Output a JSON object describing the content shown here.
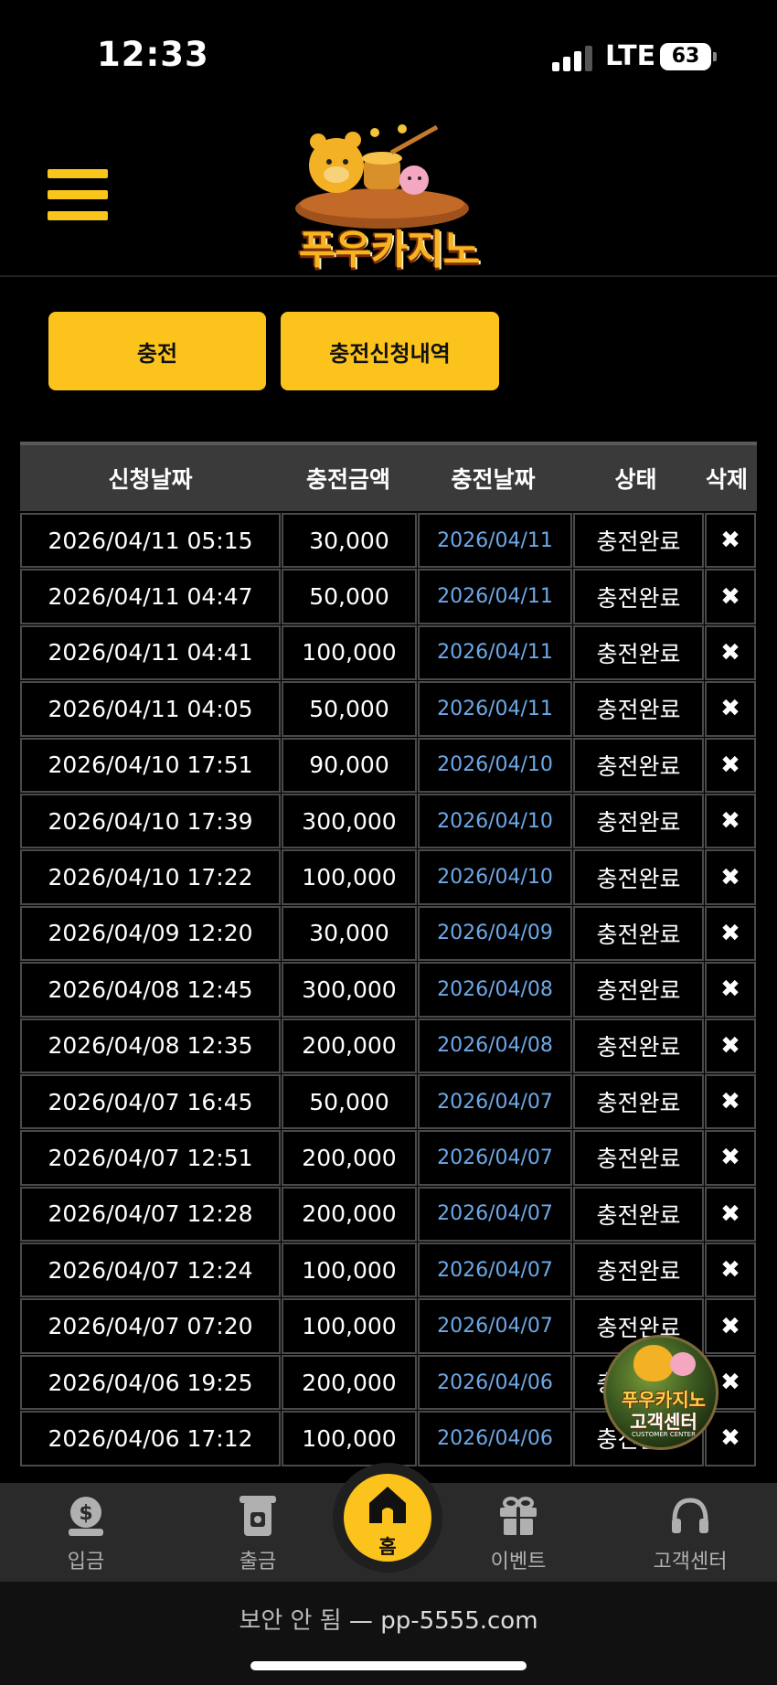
{
  "status_bar": {
    "time": "12:33",
    "network": "LTE",
    "battery": "63"
  },
  "header": {
    "logo_text": "푸우카지노",
    "menu_icon": "hamburger-icon"
  },
  "tabs": {
    "deposit_label": "충전",
    "history_label": "충전신청내역"
  },
  "table": {
    "headers": [
      "신청날짜",
      "충전금액",
      "충전날짜",
      "상태",
      "삭제"
    ],
    "rows": [
      {
        "request_date": "2026/04/11 05:15",
        "amount": "30,000",
        "charge_date": "2026/04/11",
        "status": "충전완료",
        "delete": "✖"
      },
      {
        "request_date": "2026/04/11 04:47",
        "amount": "50,000",
        "charge_date": "2026/04/11",
        "status": "충전완료",
        "delete": "✖"
      },
      {
        "request_date": "2026/04/11 04:41",
        "amount": "100,000",
        "charge_date": "2026/04/11",
        "status": "충전완료",
        "delete": "✖"
      },
      {
        "request_date": "2026/04/11 04:05",
        "amount": "50,000",
        "charge_date": "2026/04/11",
        "status": "충전완료",
        "delete": "✖"
      },
      {
        "request_date": "2026/04/10 17:51",
        "amount": "90,000",
        "charge_date": "2026/04/10",
        "status": "충전완료",
        "delete": "✖"
      },
      {
        "request_date": "2026/04/10 17:39",
        "amount": "300,000",
        "charge_date": "2026/04/10",
        "status": "충전완료",
        "delete": "✖"
      },
      {
        "request_date": "2026/04/10 17:22",
        "amount": "100,000",
        "charge_date": "2026/04/10",
        "status": "충전완료",
        "delete": "✖"
      },
      {
        "request_date": "2026/04/09 12:20",
        "amount": "30,000",
        "charge_date": "2026/04/09",
        "status": "충전완료",
        "delete": "✖"
      },
      {
        "request_date": "2026/04/08 12:45",
        "amount": "300,000",
        "charge_date": "2026/04/08",
        "status": "충전완료",
        "delete": "✖"
      },
      {
        "request_date": "2026/04/08 12:35",
        "amount": "200,000",
        "charge_date": "2026/04/08",
        "status": "충전완료",
        "delete": "✖"
      },
      {
        "request_date": "2026/04/07 16:45",
        "amount": "50,000",
        "charge_date": "2026/04/07",
        "status": "충전완료",
        "delete": "✖"
      },
      {
        "request_date": "2026/04/07 12:51",
        "amount": "200,000",
        "charge_date": "2026/04/07",
        "status": "충전완료",
        "delete": "✖"
      },
      {
        "request_date": "2026/04/07 12:28",
        "amount": "200,000",
        "charge_date": "2026/04/07",
        "status": "충전완료",
        "delete": "✖"
      },
      {
        "request_date": "2026/04/07 12:24",
        "amount": "100,000",
        "charge_date": "2026/04/07",
        "status": "충전완료",
        "delete": "✖"
      },
      {
        "request_date": "2026/04/07 07:20",
        "amount": "100,000",
        "charge_date": "2026/04/07",
        "status": "충전완료",
        "delete": "✖"
      },
      {
        "request_date": "2026/04/06 19:25",
        "amount": "200,000",
        "charge_date": "2026/04/06",
        "status": "충전완료",
        "delete": "✖"
      },
      {
        "request_date": "2026/04/06 17:12",
        "amount": "100,000",
        "charge_date": "2026/04/06",
        "status": "충전완료",
        "delete": "✖"
      }
    ]
  },
  "customer_center": {
    "name": "푸우카지노",
    "label": "고객센터",
    "english": "CUSTOMER CENTER"
  },
  "bottom_nav": {
    "deposit": "입금",
    "withdraw": "출금",
    "home": "홈",
    "event": "이벤트",
    "support": "고객센터"
  },
  "url_bar": {
    "warning": "보안 안 됨",
    "separator": "—",
    "domain": "pp-5555.com"
  },
  "colors": {
    "accent": "#fbc31b",
    "link_blue": "#6ea8e6",
    "header_row": "#3a3a3a"
  }
}
